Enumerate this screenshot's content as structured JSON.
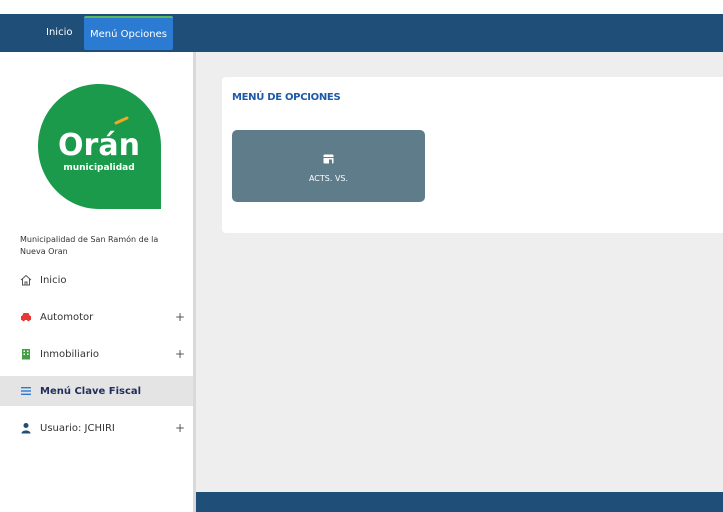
{
  "topbar": {
    "tabs": [
      {
        "label": "Inicio",
        "active": false
      },
      {
        "label": "Menú Opciones",
        "active": true
      }
    ]
  },
  "sidebar": {
    "logo": {
      "brand": "Orán",
      "subtitle": "municipalidad"
    },
    "org_name": "Municipalidad de San Ramón de la Nueva Oran",
    "items": [
      {
        "label": "Inicio",
        "icon": "home-icon"
      },
      {
        "label": "Automotor",
        "icon": "car-icon",
        "expand": "+"
      },
      {
        "label": "Inmobiliario",
        "icon": "building-icon",
        "expand": "+"
      },
      {
        "label": "Menú Clave Fiscal",
        "icon": "menu-icon",
        "active": true
      },
      {
        "label": "Usuario: JCHIRI",
        "icon": "user-icon",
        "expand": "+"
      }
    ]
  },
  "main": {
    "card_title": "MENÚ DE OPCIONES",
    "tiles": [
      {
        "label": "ACTS. VS.",
        "icon": "store-icon"
      }
    ]
  },
  "colors": {
    "topbar": "#1f4e79",
    "active_tab": "#2a7bd1",
    "logo_green": "#1a9a4a",
    "logo_accent": "#f5a623",
    "tile": "#5e7c8a"
  }
}
